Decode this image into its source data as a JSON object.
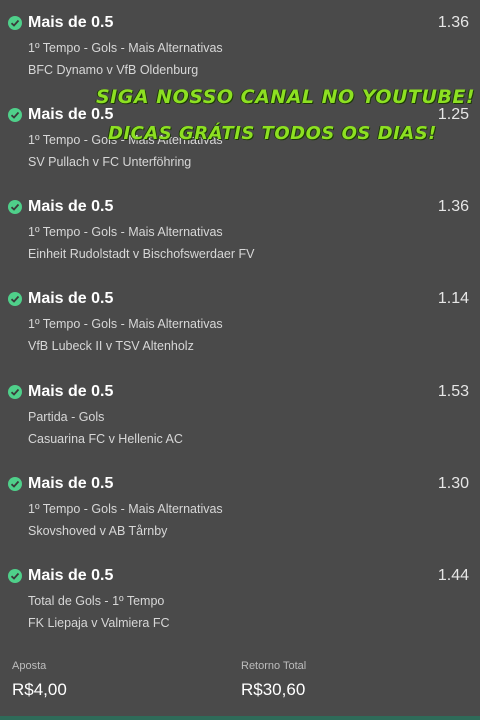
{
  "bets": [
    {
      "title": "Mais de 0.5",
      "odds": "1.36",
      "market": "1º Tempo - Gols - Mais Alternativas",
      "match": "BFC Dynamo v VfB Oldenburg"
    },
    {
      "title": "Mais de 0.5",
      "odds": "1.25",
      "market": "1º Tempo - Gols - Mais Alternativas",
      "match": "SV Pullach v FC Unterföhring"
    },
    {
      "title": "Mais de 0.5",
      "odds": "1.36",
      "market": "1º Tempo - Gols - Mais Alternativas",
      "match": "Einheit Rudolstadt v Bischofswerdaer FV"
    },
    {
      "title": "Mais de 0.5",
      "odds": "1.14",
      "market": "1º Tempo - Gols - Mais Alternativas",
      "match": "VfB Lubeck II v TSV Altenholz"
    },
    {
      "title": "Mais de 0.5",
      "odds": "1.53",
      "market": "Partida - Gols",
      "match": "Casuarina FC v Hellenic AC"
    },
    {
      "title": "Mais de 0.5",
      "odds": "1.30",
      "market": "1º Tempo - Gols - Mais Alternativas",
      "match": "Skovshoved v AB Tårnby"
    },
    {
      "title": "Mais de 0.5",
      "odds": "1.44",
      "market": "Total de Gols - 1º Tempo",
      "match": "FK Liepaja v Valmiera FC"
    }
  ],
  "promo": {
    "line1": "SIGA NOSSO CANAL NO YOUTUBE!",
    "line2": "DICAS GRÁTIS TODOS OS DIAS!"
  },
  "footer": {
    "stake_label": "Aposta",
    "stake_value": "R$4,00",
    "return_label": "Retorno Total",
    "return_value": "R$30,60"
  },
  "colors": {
    "background": "#4a4a4a",
    "check": "#4fd08a",
    "promo_text": "#8de022"
  },
  "icons": {
    "bet_status": "check-circle-icon"
  }
}
